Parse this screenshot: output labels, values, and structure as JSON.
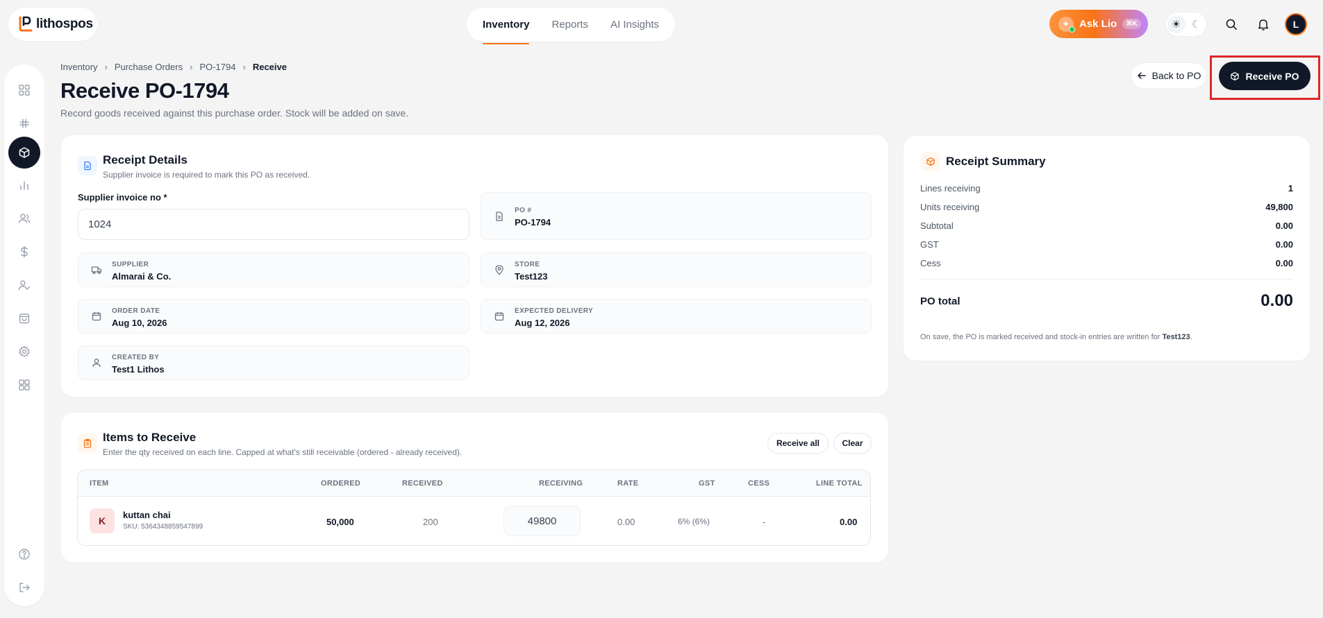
{
  "app": {
    "brand": "lithospos"
  },
  "nav": {
    "tabs": [
      "Inventory",
      "Reports",
      "AI Insights"
    ],
    "active": "Inventory"
  },
  "header": {
    "ask_label": "Ask Lio",
    "ask_shortcut": "⌘K",
    "avatar_initial": "L"
  },
  "breadcrumb": [
    "Inventory",
    "Purchase Orders",
    "PO-1794",
    "Receive"
  ],
  "page": {
    "title": "Receive PO-1794",
    "subtitle": "Record goods received against this purchase order. Stock will be added on save.",
    "back_label": "Back to PO",
    "receive_label": "Receive PO"
  },
  "receipt_details": {
    "title": "Receipt Details",
    "subtitle": "Supplier invoice is required to mark this PO as received.",
    "invoice_label": "Supplier invoice no *",
    "invoice_value": "1024",
    "po_label": "PO #",
    "po_value": "PO-1794",
    "supplier_label": "SUPPLIER",
    "supplier_value": "Almarai & Co.",
    "store_label": "STORE",
    "store_value": "Test123",
    "order_date_label": "ORDER DATE",
    "order_date_value": "Aug 10, 2026",
    "expected_label": "EXPECTED DELIVERY",
    "expected_value": "Aug 12, 2026",
    "created_label": "CREATED BY",
    "created_value": "Test1 Lithos"
  },
  "summary": {
    "title": "Receipt Summary",
    "rows": [
      {
        "label": "Lines receiving",
        "value": "1"
      },
      {
        "label": "Units receiving",
        "value": "49,800"
      },
      {
        "label": "Subtotal",
        "value": "0.00"
      },
      {
        "label": "GST",
        "value": "0.00"
      },
      {
        "label": "Cess",
        "value": "0.00"
      }
    ],
    "total_label": "PO total",
    "total_value": "0.00",
    "note_prefix": "On save, the PO is marked received and stock-in entries are written for ",
    "note_store": "Test123",
    "note_suffix": "."
  },
  "items": {
    "title": "Items to Receive",
    "subtitle": "Enter the qty received on each line. Capped at what's still receivable (ordered - already received).",
    "receive_all": "Receive all",
    "clear": "Clear",
    "columns": [
      "ITEM",
      "ORDERED",
      "RECEIVED",
      "RECEIVING",
      "RATE",
      "GST",
      "CESS",
      "LINE TOTAL"
    ],
    "rows": [
      {
        "initial": "K",
        "name": "kuttan chai",
        "sku": "SKU: 5364348859547899",
        "ordered": "50,000",
        "received": "200",
        "receiving": "49800",
        "rate": "0.00",
        "gst": "6% (6%)",
        "cess": "-",
        "line_total": "0.00"
      }
    ]
  },
  "colors": {
    "accent": "#f97316",
    "dark": "#111827",
    "highlight": "#dc2626"
  }
}
